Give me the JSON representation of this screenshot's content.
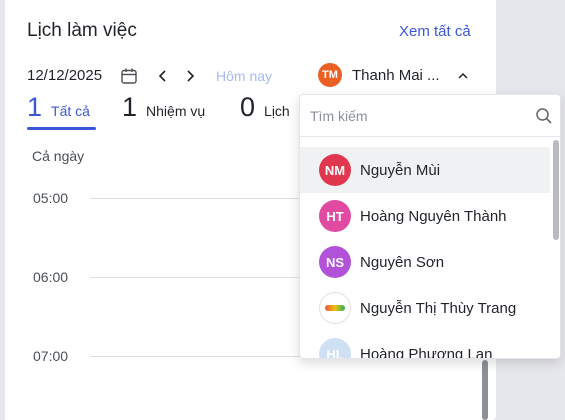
{
  "card": {
    "title": "Lịch làm việc",
    "see_all": "Xem tất cả"
  },
  "toolbar": {
    "date": "12/12/2025",
    "today_label": "Hôm nay",
    "user": {
      "initials": "TM",
      "name": "Thanh Mai ...",
      "color": "#ec5f23"
    }
  },
  "tabs": [
    {
      "count": "1",
      "label": "Tất cả",
      "active": true
    },
    {
      "count": "1",
      "label": "Nhiệm vụ",
      "active": false
    },
    {
      "count": "0",
      "label": "Lịch",
      "active": false
    }
  ],
  "timeline": {
    "all_day": "Cả ngày",
    "times": [
      "05:00",
      "06:00",
      "07:00"
    ]
  },
  "dropdown": {
    "search_placeholder": "Tìm kiếm",
    "items": [
      {
        "initials": "NM",
        "name": "Nguyễn Mùi",
        "color": "#e0374f",
        "hover": true
      },
      {
        "initials": "HT",
        "name": "Hoàng Nguyên Thành",
        "color": "#e04aa0"
      },
      {
        "initials": "NS",
        "name": "Nguyên Sơn",
        "color": "#b152d9"
      },
      {
        "initials": "",
        "name": "Nguyễn Thị Thùy Trang",
        "logo": true
      },
      {
        "initials": "HL",
        "name": "Hoàng Phượng Lan",
        "color": "#cfe0f5"
      }
    ]
  }
}
